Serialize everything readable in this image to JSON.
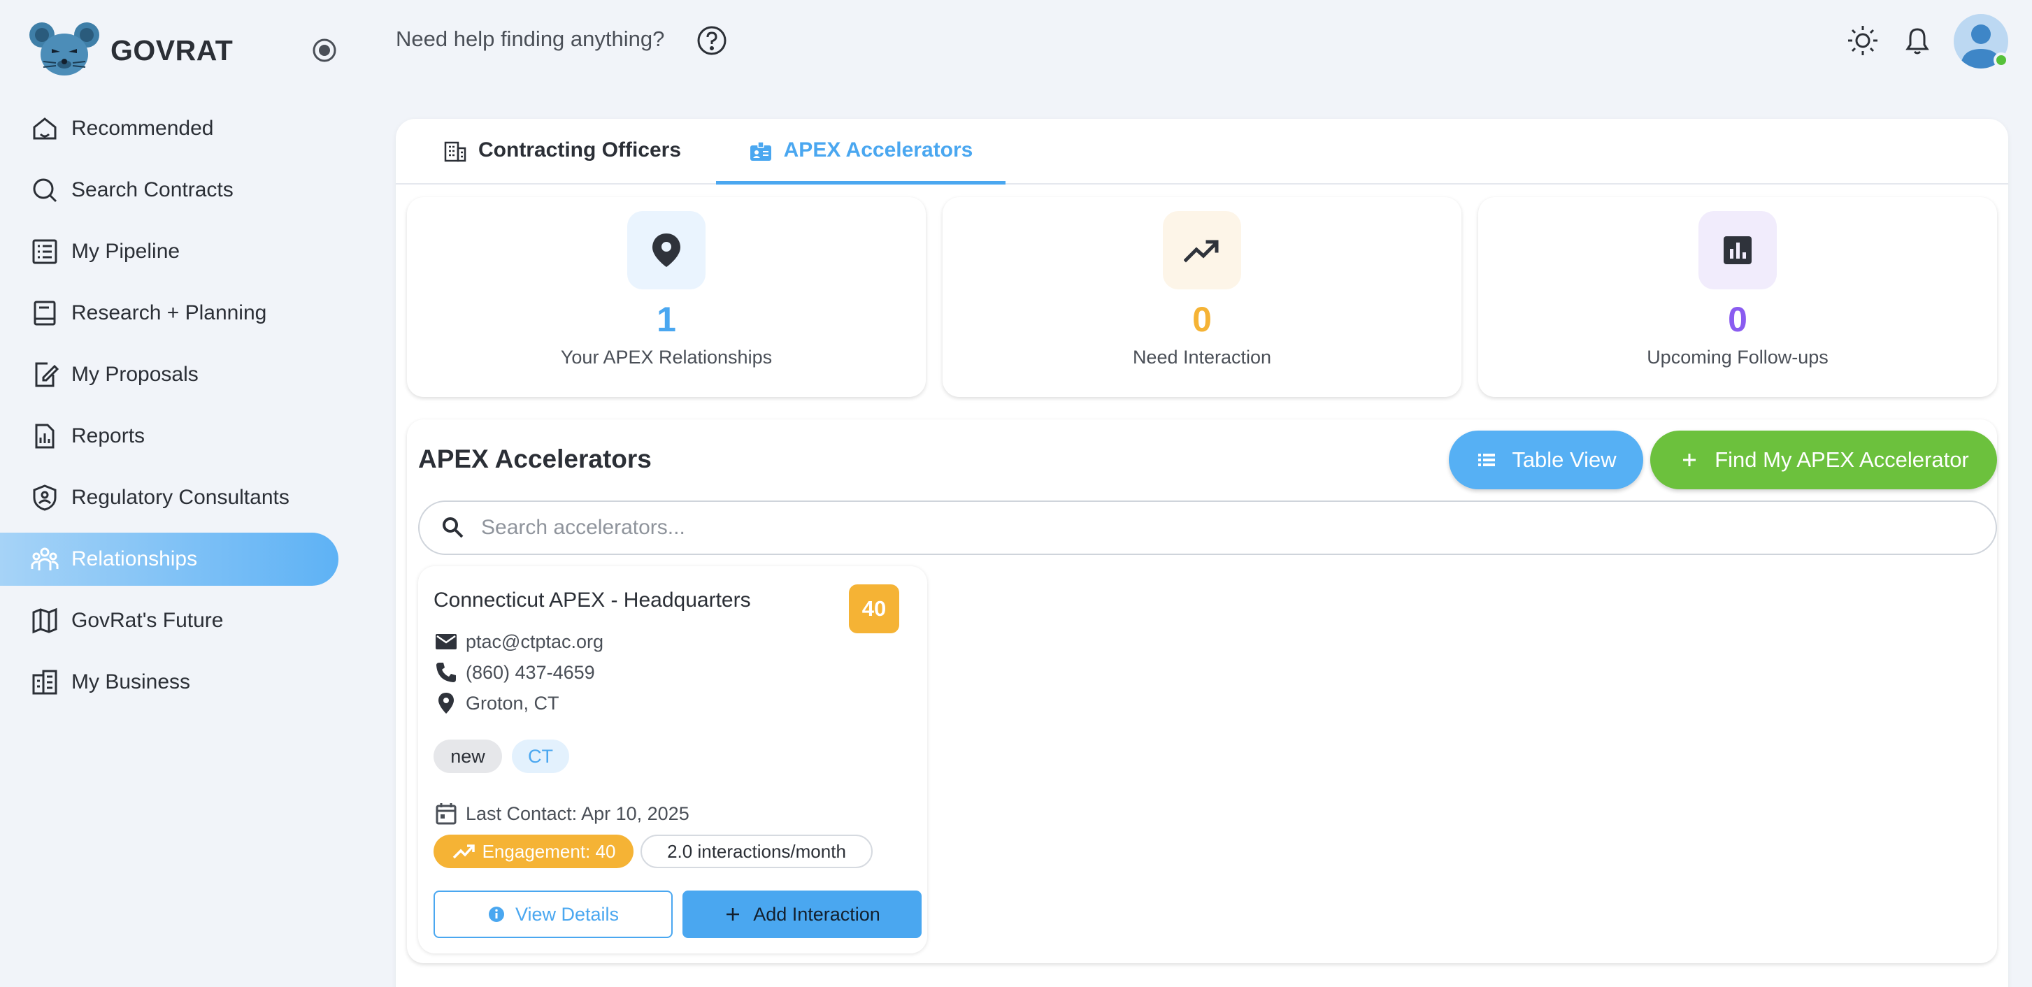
{
  "app": {
    "name": "GOVRAT"
  },
  "sidebar": {
    "items": [
      {
        "label": "Recommended",
        "icon": "home-icon"
      },
      {
        "label": "Search Contracts",
        "icon": "search-icon"
      },
      {
        "label": "My Pipeline",
        "icon": "list-icon"
      },
      {
        "label": "Research + Planning",
        "icon": "book-icon"
      },
      {
        "label": "My Proposals",
        "icon": "edit-document-icon"
      },
      {
        "label": "Reports",
        "icon": "report-icon"
      },
      {
        "label": "Regulatory Consultants",
        "icon": "shield-person-icon"
      },
      {
        "label": "Relationships",
        "icon": "people-icon",
        "active": true
      },
      {
        "label": "GovRat's Future",
        "icon": "map-icon"
      },
      {
        "label": "My Business",
        "icon": "building-icon"
      }
    ]
  },
  "topbar": {
    "help_text": "Need help finding anything?"
  },
  "tabs": [
    {
      "label": "Contracting Officers",
      "icon": "building-icon"
    },
    {
      "label": "APEX Accelerators",
      "icon": "badge-icon",
      "active": true
    }
  ],
  "stats": [
    {
      "value": "1",
      "label": "Your APEX Relationships",
      "color": "#4aa7f0",
      "bg": "#eaf4fe",
      "icon": "location-pin-icon"
    },
    {
      "value": "0",
      "label": "Need Interaction",
      "color": "#f5b335",
      "bg": "#fdf5e8",
      "icon": "trending-up-icon"
    },
    {
      "value": "0",
      "label": "Upcoming Follow-ups",
      "color": "#8a5cf0",
      "bg": "#f1ecfc",
      "icon": "bar-chart-icon"
    }
  ],
  "accelerators": {
    "title": "APEX Accelerators",
    "table_view_label": "Table View",
    "find_label": "Find My APEX Accelerator",
    "search_placeholder": "Search accelerators...",
    "card": {
      "name": "Connecticut APEX - Headquarters",
      "score": "40",
      "email": "ptac@ctptac.org",
      "phone": "(860) 437-4659",
      "location": "Groton, CT",
      "tags": [
        "new",
        "CT"
      ],
      "last_contact": "Last Contact: Apr 10, 2025",
      "engagement": "Engagement: 40",
      "rate": "2.0 interactions/month",
      "view_label": "View Details",
      "add_label": "Add Interaction"
    }
  },
  "colors": {
    "accent": "#4aa7f0",
    "green": "#6cc13d",
    "amber": "#f5b335",
    "purple": "#8a5cf0"
  }
}
